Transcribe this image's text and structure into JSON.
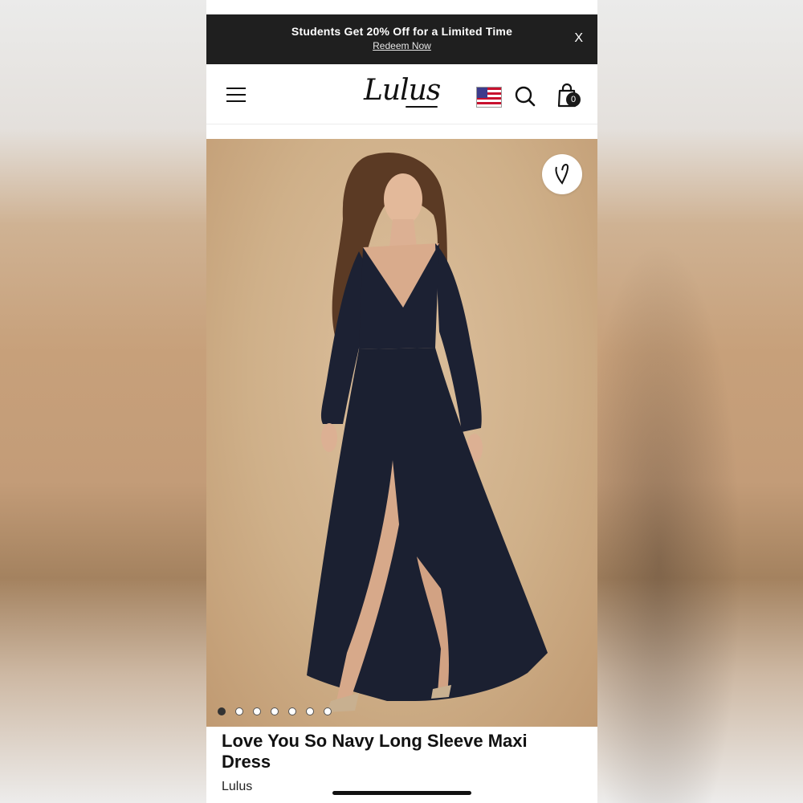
{
  "promo": {
    "text": "Students Get 20% Off for a Limited Time",
    "link": "Redeem Now",
    "close": "X"
  },
  "header": {
    "logo": "Lulus",
    "flag": "us-flag-icon",
    "cart_count": "0"
  },
  "gallery": {
    "image_count": 7,
    "active_index": 0
  },
  "product": {
    "title": "Love You So Navy Long Sleeve Maxi Dress",
    "brand": "Lulus"
  },
  "colors": {
    "promo_bg": "#1f1f1f",
    "photo_bg": "#cfb089",
    "dress": "#1c2133"
  }
}
